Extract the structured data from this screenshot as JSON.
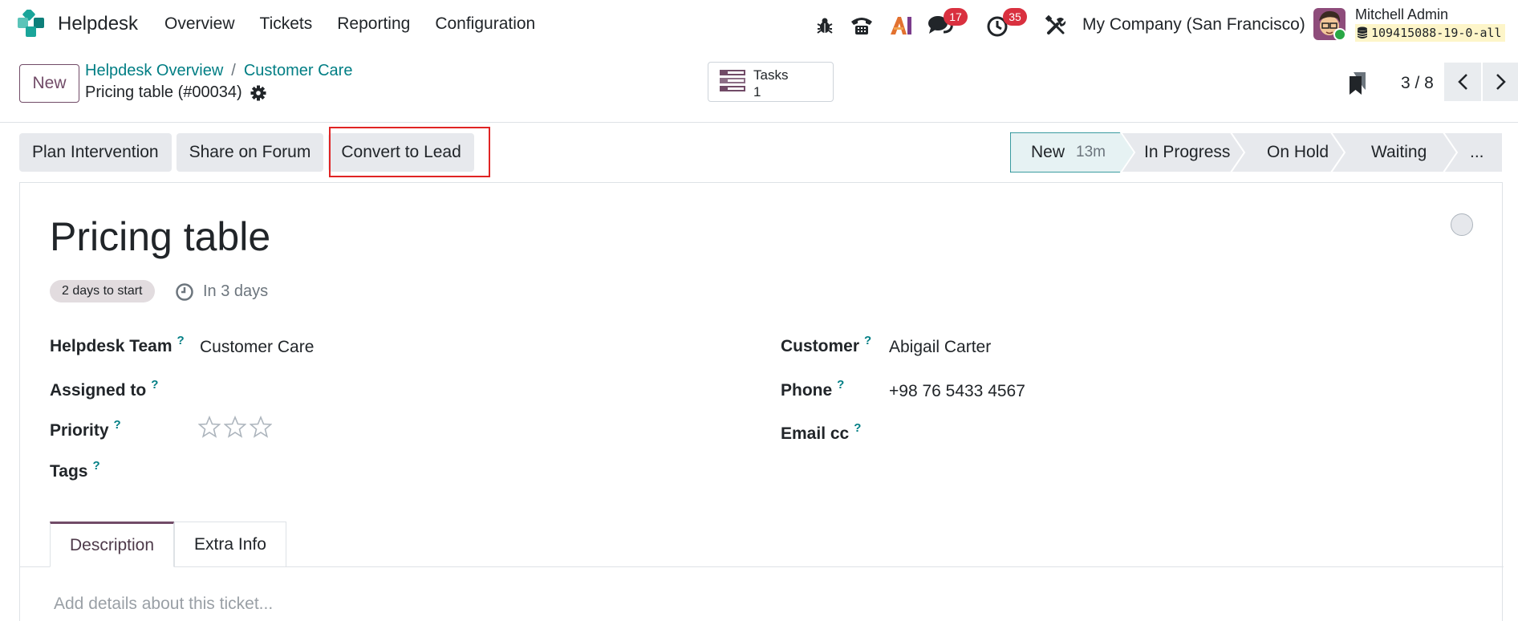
{
  "navbar": {
    "app_name": "Helpdesk",
    "menu": [
      "Overview",
      "Tickets",
      "Reporting",
      "Configuration"
    ],
    "messages_count": "17",
    "activities_count": "35",
    "company": "My Company (San Francisco)",
    "user_name": "Mitchell Admin",
    "database": "109415088-19-0-all"
  },
  "control": {
    "new_label": "New",
    "breadcrumb": [
      "Helpdesk Overview",
      "Customer Care"
    ],
    "record_title": "Pricing table (#00034)",
    "smart_button": {
      "label": "Tasks",
      "value": "1"
    },
    "pager": "3 / 8"
  },
  "actions": [
    "Plan Intervention",
    "Share on Forum",
    "Convert to Lead"
  ],
  "stages": {
    "items": [
      "New",
      "In Progress",
      "On Hold",
      "Waiting",
      "..."
    ],
    "current_time": "13m"
  },
  "form": {
    "title": "Pricing table",
    "deadline_badge": "2 days to start",
    "deadline_text": "In 3 days",
    "help_mark": "?",
    "fields_left": [
      {
        "label": "Helpdesk Team",
        "value": "Customer Care"
      },
      {
        "label": "Assigned to",
        "value": ""
      },
      {
        "label": "Priority",
        "value": ""
      },
      {
        "label": "Tags",
        "value": ""
      }
    ],
    "priority_stars": 0,
    "fields_right": [
      {
        "label": "Customer",
        "value": "Abigail Carter"
      },
      {
        "label": "Phone",
        "value": "+98 76 5433 4567"
      },
      {
        "label": "Email cc",
        "value": ""
      }
    ],
    "tabs": [
      "Description",
      "Extra Info"
    ],
    "description_placeholder": "Add details about this ticket..."
  }
}
